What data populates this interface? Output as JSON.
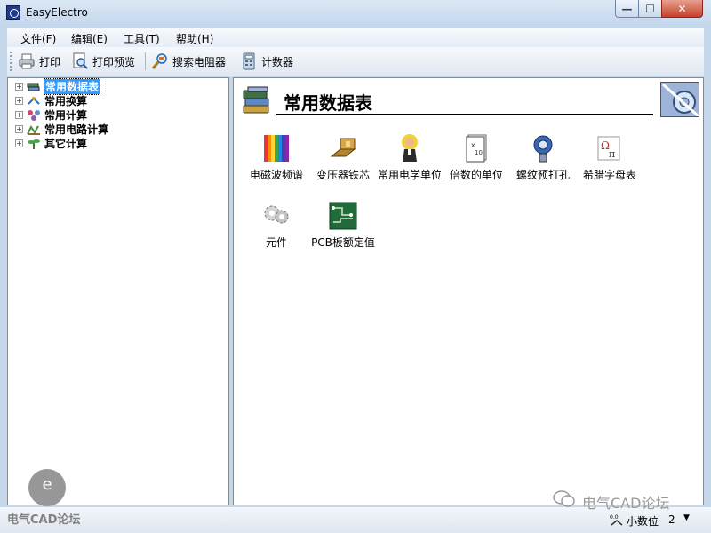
{
  "window": {
    "title": "EasyElectro",
    "min_label": "—",
    "max_label": "☐",
    "close_label": "✕"
  },
  "menu": [
    {
      "label": "文件(F)"
    },
    {
      "label": "编辑(E)"
    },
    {
      "label": "工具(T)"
    },
    {
      "label": "帮助(H)"
    }
  ],
  "toolbar": {
    "print_label": "打印",
    "preview_label": "打印预览",
    "resistor_label": "搜索电阻器",
    "calculator_label": "计数器"
  },
  "tree": [
    {
      "label": "常用数据表",
      "expander": "+",
      "selected": true
    },
    {
      "label": "常用换算",
      "expander": "+"
    },
    {
      "label": "常用计算",
      "expander": "+"
    },
    {
      "label": "常用电路计算",
      "expander": "+"
    },
    {
      "label": "其它计算",
      "expander": "+"
    }
  ],
  "content": {
    "title": "常用数据表",
    "items": [
      {
        "label": "电磁波频谱",
        "icon": "spectrum-icon"
      },
      {
        "label": "变压器铁芯",
        "icon": "transformer-core-icon"
      },
      {
        "label": "常用电学单位",
        "icon": "scientist-icon"
      },
      {
        "label": "倍数的单位",
        "icon": "document-units-icon"
      },
      {
        "label": "螺纹预打孔",
        "icon": "screw-thread-icon"
      },
      {
        "label": "希腊字母表",
        "icon": "greek-letters-icon"
      },
      {
        "label": "元件",
        "icon": "components-icon"
      },
      {
        "label": "PCB板额定值",
        "icon": "pcb-icon"
      }
    ]
  },
  "statusbar": {
    "decimal_label": "小数位",
    "decimal_value": "2",
    "dropdown_arrow": "▼"
  },
  "watermark": {
    "left_text": "电气CAD论坛",
    "right_text": "电气CAD论坛",
    "logo_text": "e"
  }
}
